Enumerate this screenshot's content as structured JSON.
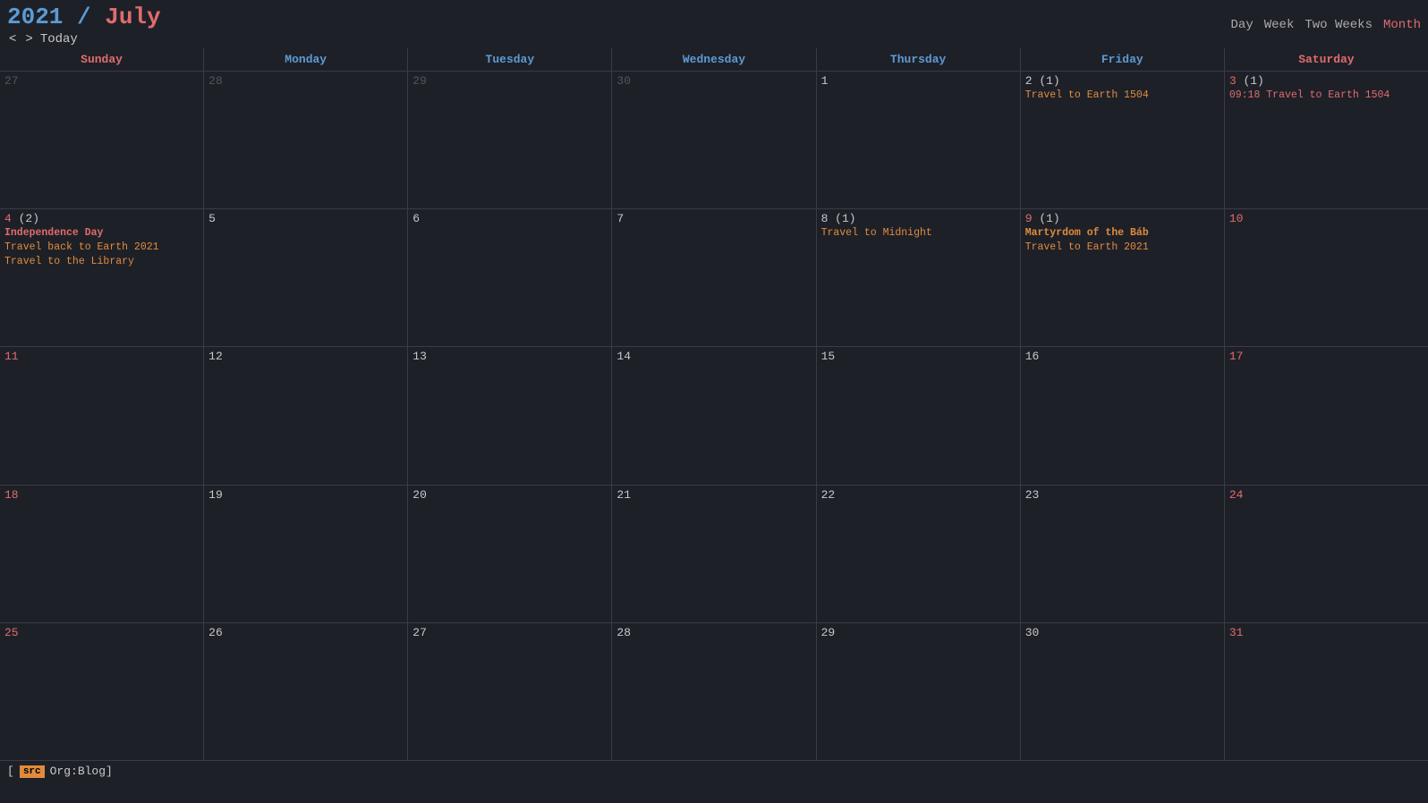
{
  "header": {
    "year": "2021",
    "separator": " / ",
    "month": "July",
    "nav": {
      "prev": "<",
      "next": ">",
      "today": "Today"
    },
    "views": [
      "Day",
      "Week",
      "Two Weeks",
      "Month"
    ],
    "active_view": "Month"
  },
  "days_of_week": [
    {
      "label": "Sunday",
      "type": "weekend"
    },
    {
      "label": "Monday",
      "type": "weekday"
    },
    {
      "label": "Tuesday",
      "type": "weekday"
    },
    {
      "label": "Wednesday",
      "type": "weekday"
    },
    {
      "label": "Thursday",
      "type": "weekday"
    },
    {
      "label": "Friday",
      "type": "weekday"
    },
    {
      "label": "Saturday",
      "type": "weekend"
    }
  ],
  "weeks": [
    {
      "days": [
        {
          "num": "27",
          "other_month": true,
          "events": []
        },
        {
          "num": "28",
          "other_month": true,
          "events": []
        },
        {
          "num": "29",
          "other_month": true,
          "events": []
        },
        {
          "num": "30",
          "other_month": true,
          "events": []
        },
        {
          "num": "1",
          "events": []
        },
        {
          "num": "2",
          "event_count": "(1)",
          "events": [
            {
              "text": "Travel to Earth 1504",
              "style": "orange"
            }
          ]
        },
        {
          "num": "3",
          "weekend": true,
          "event_count": "(1)",
          "events": [
            {
              "text": "09:18 Travel to Earth 1504",
              "style": "time-red"
            }
          ]
        }
      ]
    },
    {
      "days": [
        {
          "num": "4",
          "weekend": true,
          "event_count": "(2)",
          "events": [
            {
              "text": "Independence Day",
              "style": "bold"
            },
            {
              "text": "Travel back to Earth 2021",
              "style": "orange"
            },
            {
              "text": "Travel to the Library",
              "style": "orange"
            }
          ]
        },
        {
          "num": "5",
          "events": []
        },
        {
          "num": "6",
          "events": []
        },
        {
          "num": "7",
          "events": []
        },
        {
          "num": "8",
          "event_count": "(1)",
          "events": [
            {
              "text": "Travel to Midnight",
              "style": "orange"
            }
          ]
        },
        {
          "num": "9",
          "event_count": "(1)",
          "events": [
            {
              "text": "Martyrdom of the Báb",
              "style": "bold-orange"
            },
            {
              "text": "Travel to Earth 2021",
              "style": "orange"
            }
          ]
        },
        {
          "num": "10",
          "weekend": true,
          "events": []
        }
      ]
    },
    {
      "days": [
        {
          "num": "11",
          "weekend": true,
          "events": []
        },
        {
          "num": "12",
          "events": []
        },
        {
          "num": "13",
          "events": []
        },
        {
          "num": "14",
          "events": []
        },
        {
          "num": "15",
          "events": []
        },
        {
          "num": "16",
          "events": []
        },
        {
          "num": "17",
          "weekend": true,
          "events": []
        }
      ]
    },
    {
      "days": [
        {
          "num": "18",
          "weekend": true,
          "events": []
        },
        {
          "num": "19",
          "events": []
        },
        {
          "num": "20",
          "events": []
        },
        {
          "num": "21",
          "events": []
        },
        {
          "num": "22",
          "events": []
        },
        {
          "num": "23",
          "events": []
        },
        {
          "num": "24",
          "weekend": true,
          "events": []
        }
      ]
    },
    {
      "days": [
        {
          "num": "25",
          "weekend": true,
          "events": []
        },
        {
          "num": "26",
          "events": []
        },
        {
          "num": "27",
          "events": []
        },
        {
          "num": "28",
          "events": []
        },
        {
          "num": "29",
          "events": []
        },
        {
          "num": "30",
          "today": true,
          "events": []
        },
        {
          "num": "31",
          "weekend": true,
          "events": []
        }
      ]
    }
  ],
  "footer": {
    "tag": "src",
    "label": "Org:Blog]"
  }
}
